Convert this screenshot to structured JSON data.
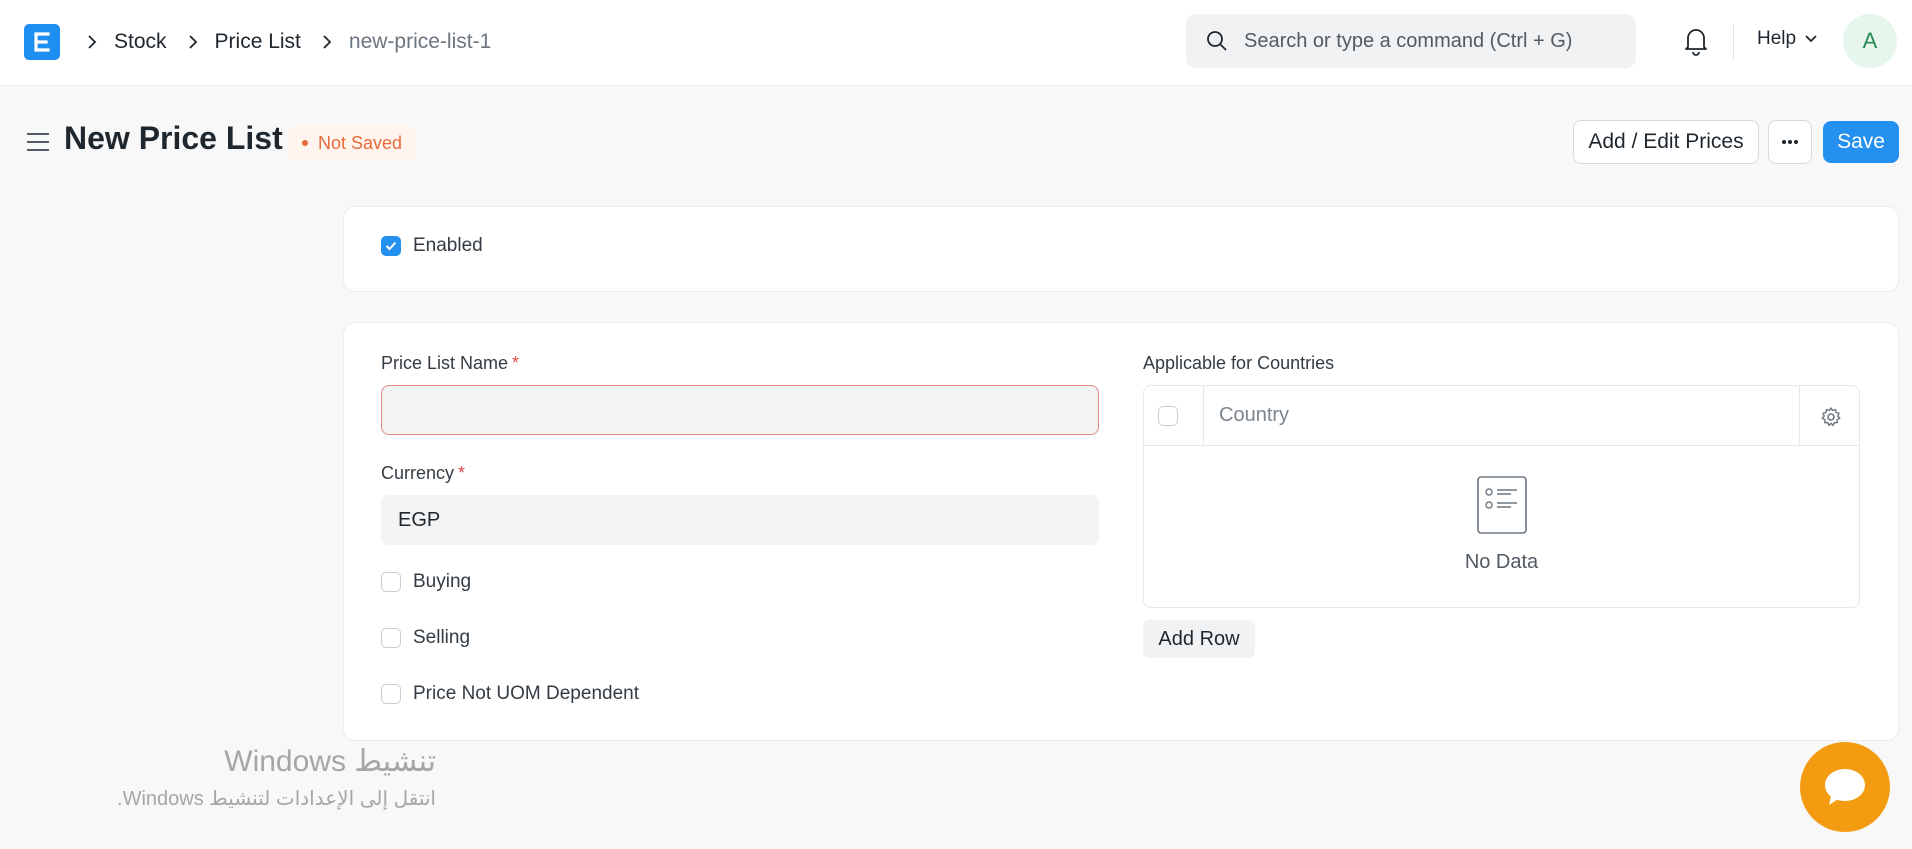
{
  "navbar": {
    "breadcrumbs": [
      {
        "label": "Stock"
      },
      {
        "label": "Price List"
      },
      {
        "label": "new-price-list-1"
      }
    ],
    "search_placeholder": "Search or type a command (Ctrl + G)",
    "help_label": "Help",
    "avatar_initial": "A"
  },
  "header": {
    "title": "New Price List",
    "status": "Not Saved",
    "add_edit_prices_label": "Add / Edit Prices",
    "more_label": "···",
    "save_label": "Save"
  },
  "form": {
    "enabled_label": "Enabled",
    "enabled_checked": true,
    "price_list_name_label": "Price List Name",
    "price_list_name_value": "",
    "required_mark": "*",
    "currency_label": "Currency",
    "currency_value": "EGP",
    "buying_label": "Buying",
    "selling_label": "Selling",
    "uom_label": "Price Not UOM Dependent",
    "countries_label": "Applicable for Countries",
    "countries_table": {
      "column": "Country",
      "empty_text": "No Data",
      "add_row_label": "Add Row"
    }
  },
  "watermark": {
    "title": "تنشيط Windows",
    "subtitle": "انتقل إلى الإعدادات لتنشيط Windows."
  },
  "colors": {
    "primary": "#2490ef",
    "status": "#e86c3a",
    "chat": "#f39c12"
  }
}
